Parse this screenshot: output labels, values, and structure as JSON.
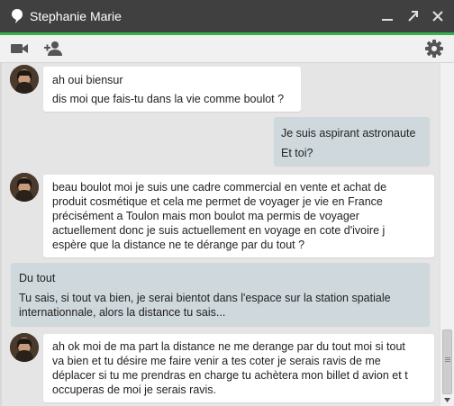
{
  "window": {
    "title": "Stephanie Marie",
    "status_icon": "status-dot-icon",
    "minimize_icon": "minimize-icon",
    "popout_icon": "popout-arrow-icon",
    "close_icon": "close-icon",
    "accent_color": "#35b34a",
    "titlebar_color": "#404040"
  },
  "toolbar": {
    "video_icon": "video-camera-icon",
    "add_person_icon": "add-person-icon",
    "settings_icon": "gear-icon"
  },
  "messages": [
    {
      "from": "them",
      "lines": [
        "ah oui biensur",
        "dis moi que fais-tu dans la vie comme boulot ?"
      ]
    },
    {
      "from": "me",
      "lines": [
        "Je suis aspirant astronaute",
        "Et toi?"
      ]
    },
    {
      "from": "them",
      "text": "beau boulot moi je suis une cadre commercial en vente et achat de\nproduit cosmétique et cela me permet de voyager je vie en France\nprécisément a Toulon mais mon boulot ma permis de voyager\nactuellement donc je suis actuellement en voyage en cote d'ivoire j\nespère que la distance ne te dérange par du tout ?"
    },
    {
      "from": "me",
      "title": "Du tout",
      "text": "Tu sais, si tout va bien, je serai bientot dans l'espace sur la station spatiale\ninternationnale, alors la distance tu sais..."
    },
    {
      "from": "them",
      "text": "ah ok moi de ma part la distance ne me derange par du tout moi si tout\nva bien et tu désire me faire venir a tes coter je serais ravis de me\ndéplacer si tu me prendras en charge tu achètera mon billet d avion et t\noccuperas de moi je serais ravis."
    }
  ]
}
